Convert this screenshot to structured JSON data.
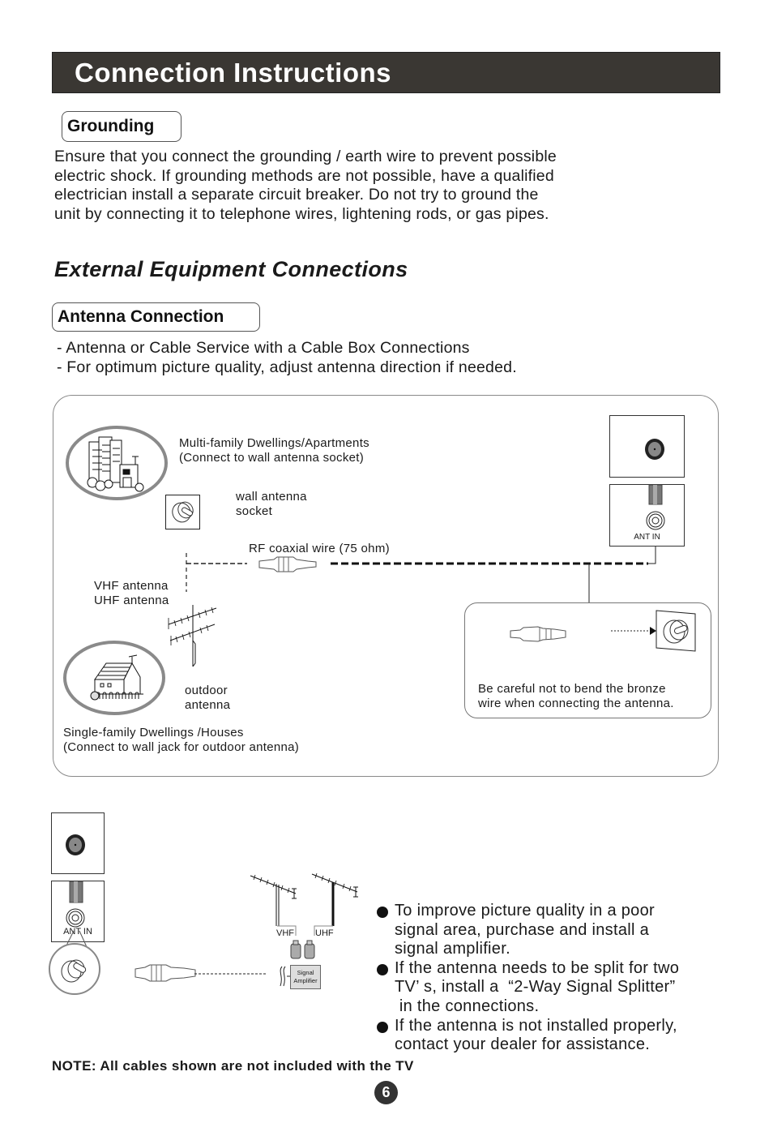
{
  "header": {
    "title": "Connection Instructions"
  },
  "grounding": {
    "label": "Grounding",
    "lines": [
      "Ensure that you connect the grounding / earth wire to prevent possible",
      "electric shock. If grounding methods are not possible, have a qualified",
      "electrician install a separate circuit breaker. Do not try to ground the",
      "unit by connecting it to telephone wires, lightening rods, or gas pipes."
    ]
  },
  "external": {
    "title": "External Equipment Connections",
    "antenna_label": "Antenna Connection",
    "intro": [
      "- Antenna or Cable Service with a Cable Box Connections",
      "- For optimum picture quality, adjust antenna direction if needed."
    ]
  },
  "diagram1": {
    "multi_family": [
      "Multi-family Dwellings/Apartments",
      "(Connect to wall antenna socket)"
    ],
    "wall_socket": [
      "wall antenna",
      "socket"
    ],
    "rf_wire": "RF coaxial wire (75 ohm)",
    "vhf_uhf": [
      "VHF antenna",
      "UHF antenna"
    ],
    "outdoor": [
      "outdoor",
      "antenna"
    ],
    "single_family": [
      "Single-family Dwellings /Houses",
      "(Connect to wall jack for outdoor antenna)"
    ],
    "ant_in": "ANT IN",
    "caution": [
      "Be careful not to bend the bronze",
      "wire when connecting the antenna."
    ]
  },
  "diagram2": {
    "ant_in": "ANT IN",
    "vhf": "VHF",
    "uhf": "UHF",
    "amplifier": [
      "Signal",
      "Amplifier"
    ]
  },
  "tips": [
    [
      "To improve picture quality in a poor",
      "signal area, purchase and install a",
      "signal amplifier."
    ],
    [
      "If the antenna needs to be split for two",
      "TV’ s, install a  “2-Way Signal Splitter”",
      " in the connections."
    ],
    [
      "If the antenna is not installed properly,",
      "contact your dealer for assistance."
    ]
  ],
  "note": "NOTE: All cables shown are not included with the TV",
  "page_number": "6"
}
